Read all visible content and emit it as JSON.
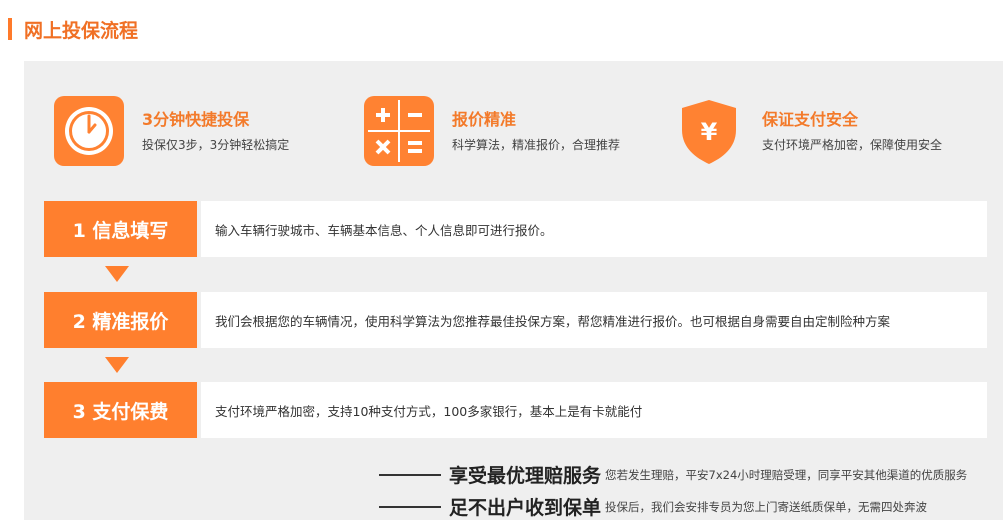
{
  "header": {
    "title": "网上投保流程"
  },
  "features": [
    {
      "icon": "clock-icon",
      "title": "3分钟快捷投保",
      "subtitle": "投保仅3步，3分钟轻松搞定"
    },
    {
      "icon": "calculator-icon",
      "title": "报价精准",
      "subtitle": "科学算法，精准报价，合理推荐"
    },
    {
      "icon": "yen-shield-icon",
      "title": "保证支付安全",
      "subtitle": "支付环境严格加密，保障使用安全"
    }
  ],
  "steps": [
    {
      "label": "1 信息填写",
      "desc": "输入车辆行驶城市、车辆基本信息、个人信息即可进行报价。"
    },
    {
      "label": "2 精准报价",
      "desc": "我们会根据您的车辆情况，使用科学算法为您推荐最佳投保方案，帮您精准进行报价。也可根据自身需要自由定制险种方案"
    },
    {
      "label": "3 支付保费",
      "desc": "支付环境严格加密，支持10种支付方式，100多家银行，基本上是有卡就能付"
    }
  ],
  "promos": [
    {
      "title": "享受最优理赔服务",
      "text": "您若发生理赔，平安7x24小时理赔受理，同享平安其他渠道的优质服务"
    },
    {
      "title": "足不出户收到保单",
      "text": "投保后，我们会安排专员为您上门寄送纸质保单，无需四处奔波"
    }
  ],
  "colors": {
    "accent": "#ff7f2e",
    "panel": "#efefef",
    "title": "#f07025"
  }
}
